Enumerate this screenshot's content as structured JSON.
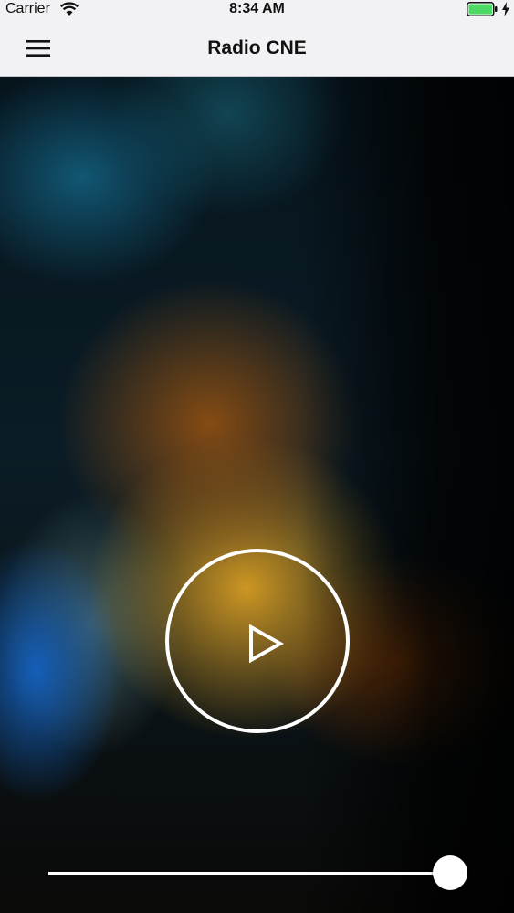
{
  "status_bar": {
    "carrier": "Carrier",
    "time": "8:34 AM",
    "wifi_icon": "wifi-icon",
    "battery_icon": "battery-charging-icon",
    "battery_color": "#4cd964"
  },
  "nav_bar": {
    "title": "Radio CNE",
    "menu_icon": "hamburger-menu-icon"
  },
  "player": {
    "play_icon": "play-icon",
    "volume_level": 1.0
  },
  "colors": {
    "bar_background": "#f2f2f4",
    "control_color": "#ffffff"
  }
}
